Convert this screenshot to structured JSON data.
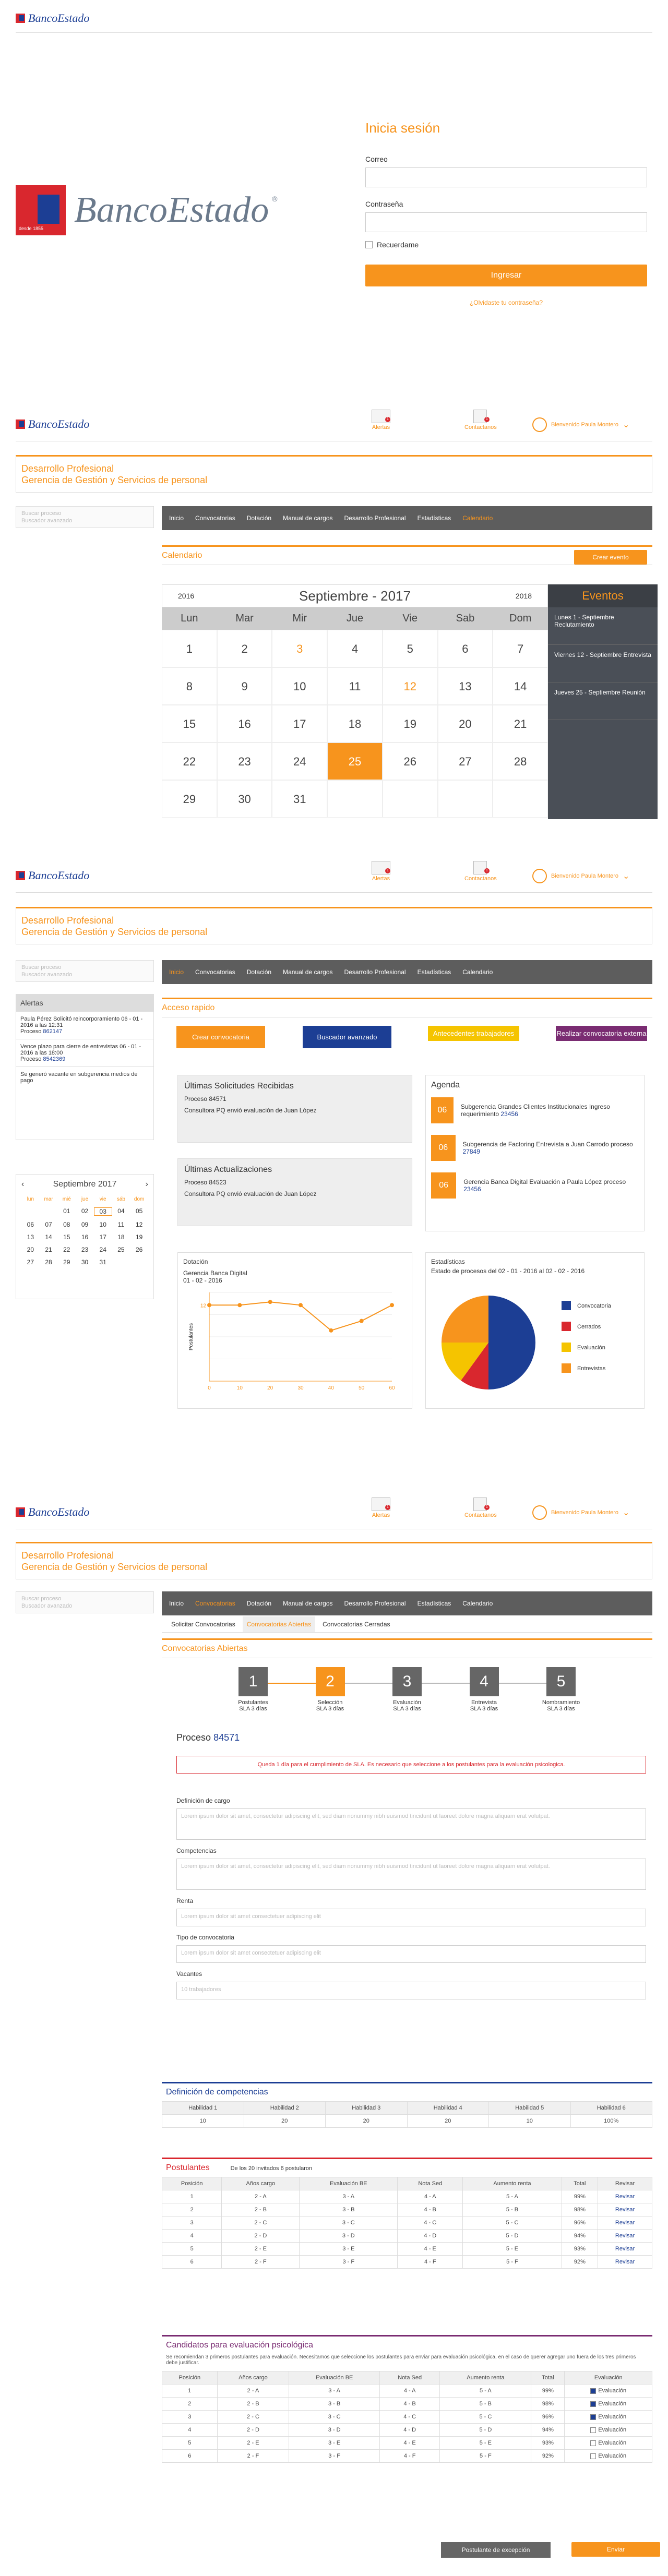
{
  "brand": {
    "name": "BancoEstado",
    "tagline": "desde 1855"
  },
  "login": {
    "title": "Inicia sesión",
    "user_label": "Correo",
    "pass_label": "Contraseña",
    "remember": "Recuerdame",
    "submit": "Ingresar",
    "forgot": "¿Olvidaste tu contraseña?"
  },
  "header": {
    "alerts": "Alertas",
    "alerts_count": "1",
    "contacts": "Contactanos",
    "contacts_count": "1",
    "user": "Bienvenido Paula Montero"
  },
  "page": {
    "title1": "Desarrollo Profesional",
    "title2": "Gerencia de Gestión y Servicios de personal"
  },
  "search": {
    "placeholder": "Buscar proceso",
    "hint": "Buscador avanzado"
  },
  "nav": [
    "Inicio",
    "Convocatorias",
    "Dotación",
    "Manual de cargos",
    "Desarrollo Profesional",
    "Estadísticas",
    "Calendario"
  ],
  "calendar": {
    "header": "Calendario",
    "new_event": "Crear evento",
    "prev_year": "2016",
    "next_year": "2018",
    "month": "Septiembre - 2017",
    "days": [
      "Lun",
      "Mar",
      "Mir",
      "Jue",
      "Vie",
      "Sab",
      "Dom"
    ],
    "weeks": [
      [
        "1",
        "2",
        "3",
        "4",
        "5",
        "6",
        "7"
      ],
      [
        "8",
        "9",
        "10",
        "11",
        "12",
        "13",
        "14"
      ],
      [
        "15",
        "16",
        "17",
        "18",
        "19",
        "20",
        "21"
      ],
      [
        "22",
        "23",
        "24",
        "25",
        "26",
        "27",
        "28"
      ],
      [
        "29",
        "30",
        "31",
        "",
        "",
        "",
        ""
      ]
    ],
    "events_title": "Eventos",
    "events": [
      "Lunes 1 - Septiembre Reclutamiento",
      "Viernes 12 - Septiembre Entrevista",
      "Jueves 25 - Septiembre Reunión"
    ]
  },
  "dashboard": {
    "alerts_title": "Alertas",
    "alerts": [
      {
        "text": "Paula Pérez Solicitó reincorporamiento 06 - 01 - 2016 a las 12:31",
        "proc": "Proceso",
        "id": "862147"
      },
      {
        "text": "Vence plazo para cierre de entrevistas 06 - 01 - 2016 a las 18:00",
        "proc": "Proceso",
        "id": "8542369"
      },
      {
        "text": "Se generó vacante en subgerencia medios de pago",
        "proc": "",
        "id": ""
      }
    ],
    "mini_cal": {
      "month": "Septiembre 2017",
      "days": [
        "lun",
        "mar",
        "mié",
        "jue",
        "vie",
        "sáb",
        "dom"
      ],
      "rows": [
        [
          "",
          "",
          "01",
          "02",
          "03",
          "04",
          "05"
        ],
        [
          "06",
          "07",
          "08",
          "09",
          "10",
          "11",
          "12"
        ],
        [
          "13",
          "14",
          "15",
          "16",
          "17",
          "18",
          "19"
        ],
        [
          "20",
          "21",
          "22",
          "23",
          "24",
          "25",
          "26"
        ],
        [
          "27",
          "28",
          "29",
          "30",
          "31",
          "",
          ""
        ]
      ]
    },
    "quick_title": "Acceso rapido",
    "quick": [
      "Crear convocatoria",
      "Buscador avanzado",
      "Antecedentes trabajadores",
      "Realizar convocatoria externa"
    ],
    "last_req_title": "Últimas Solicitudes Recibidas",
    "last_req": [
      "Proceso 84571",
      "Consultora PQ envió evaluación de Juan López"
    ],
    "last_upd_title": "Últimas Actualizaciones",
    "last_upd": [
      "Proceso 84523",
      "Consultora PQ envió evaluación de Juan López"
    ],
    "agenda_title": "Agenda",
    "agenda": [
      {
        "day": "06",
        "text": "Subgerencia Grandes Clientes Institucionales Ingreso requerimiento",
        "id": "23456"
      },
      {
        "day": "06",
        "text": "Subgerencia de Factoring Entrevista a Juan Carrodo proceso",
        "id": "27849"
      },
      {
        "day": "06",
        "text": "Gerencia Banca Digital Evaluación a Paula López proceso",
        "id": "23456"
      }
    ],
    "dotacion_title": "Dotación",
    "dotacion_sub": "Gerencia Banca Digital",
    "dotacion_date": "01 - 02 - 2016",
    "ylabel": "Postulantes",
    "stats_title": "Estadísticas",
    "stats_sub": "Estado de procesos del 02 - 01 - 2016 al 02 - 02 - 2016"
  },
  "chart_data": [
    {
      "type": "line",
      "x": [
        0,
        10,
        20,
        30,
        40,
        50,
        60
      ],
      "values": [
        12,
        12,
        12.5,
        12,
        8,
        9.5,
        12
      ],
      "xlabel": "",
      "ylabel": "Postulantes",
      "ylim": [
        0,
        14
      ]
    },
    {
      "type": "pie",
      "categories": [
        "Convocatoria",
        "Cerrados",
        "Evaluación",
        "Entrevistas"
      ],
      "values": [
        50,
        10,
        15,
        25
      ],
      "colors": [
        "#1c3e94",
        "#d9272e",
        "#f5c400",
        "#f7941d"
      ],
      "legend": "right"
    }
  ],
  "process": {
    "tabs": [
      "Solicitar Convocatorias",
      "Convocatorias Abiertas",
      "Convocatorias Cerradas"
    ],
    "header": "Convocatorias Abiertas",
    "steps": [
      {
        "n": "1",
        "label": "Postulantes",
        "sla": "SLA 3 días"
      },
      {
        "n": "2",
        "label": "Selección",
        "sla": "SLA 3 días"
      },
      {
        "n": "3",
        "label": "Evaluación",
        "sla": "SLA 3 días"
      },
      {
        "n": "4",
        "label": "Entrevista",
        "sla": "SLA 3 días"
      },
      {
        "n": "5",
        "label": "Nombramiento",
        "sla": "SLA 3 días"
      }
    ],
    "proc_label": "Proceso",
    "proc_id": "84571",
    "warning": "Queda 1 día para el cumplimiento de SLA. Es necesario que seleccione a los postulantes para la evaluación psicologica.",
    "fields": [
      {
        "label": "Definición de cargo",
        "value": "Lorem ipsum dolor sit amet, consectetur adipiscing elit, sed diam nonummy nibh euismod tincidunt ut laoreet dolore magna aliquam erat volutpat."
      },
      {
        "label": "Competencias",
        "value": "Lorem ipsum dolor sit amet, consectetur adipiscing elit, sed diam nonummy nibh euismod tincidunt ut laoreet dolore magna aliquam erat volutpat."
      },
      {
        "label": "Renta",
        "value": "Lorem ipsum dolor sit amet consectetuer adipiscing elit"
      },
      {
        "label": "Tipo de convocatoria",
        "value": "Lorem ipsum dolor sit amet consectetuer adipiscing elit"
      },
      {
        "label": "Vacantes",
        "value": "10 trabajadores"
      }
    ]
  },
  "competencias": {
    "title": "Definición de competencias",
    "headers": [
      "Habilidad 1",
      "Habilidad 2",
      "Habilidad 3",
      "Habilidad 4",
      "Habilidad 5",
      "Habilidad 6"
    ],
    "values": [
      "10",
      "20",
      "20",
      "20",
      "10",
      "100%"
    ]
  },
  "postulantes": {
    "title": "Postulantes",
    "sub": "De los 20 invitados 6 postularon",
    "headers": [
      "Posición",
      "Años cargo",
      "Evaluación BE",
      "Nota Sed",
      "Aumento renta",
      "Total",
      "Revisar"
    ],
    "rows": [
      [
        "1",
        "2 - A",
        "3 - A",
        "4 - A",
        "5 - A",
        "99%",
        "Revisar"
      ],
      [
        "2",
        "2 - B",
        "3 - B",
        "4 - B",
        "5 - B",
        "98%",
        "Revisar"
      ],
      [
        "3",
        "2 - C",
        "3 - C",
        "4 - C",
        "5 - C",
        "96%",
        "Revisar"
      ],
      [
        "4",
        "2 - D",
        "3 - D",
        "4 - D",
        "5 - D",
        "94%",
        "Revisar"
      ],
      [
        "5",
        "2 - E",
        "3 - E",
        "4 - E",
        "5 - E",
        "93%",
        "Revisar"
      ],
      [
        "6",
        "2 - F",
        "3 - F",
        "4 - F",
        "5 - F",
        "92%",
        "Revisar"
      ]
    ]
  },
  "candidatos": {
    "title": "Candidatos para evaluación psicológica",
    "note": "Se recomiendan 3 primeros postulantes para evaluación. Necesitamos que seleccione los postulantes para enviar para evaluación psicológica, en el caso de querer agregar uno fuera de los tres primeros debe justificar.",
    "headers": [
      "Posición",
      "Años cargo",
      "Evaluación BE",
      "Nota Sed",
      "Aumento renta",
      "Total",
      "Evaluación"
    ],
    "rows": [
      [
        "1",
        "2 - A",
        "3 - A",
        "4 - A",
        "5 - A",
        "99%",
        "Evaluación"
      ],
      [
        "2",
        "2 - B",
        "3 - B",
        "4 - B",
        "5 - B",
        "98%",
        "Evaluación"
      ],
      [
        "3",
        "2 - C",
        "3 - C",
        "4 - C",
        "5 - C",
        "96%",
        "Evaluación"
      ],
      [
        "4",
        "2 - D",
        "3 - D",
        "4 - D",
        "5 - D",
        "94%",
        "Evaluación"
      ],
      [
        "5",
        "2 - E",
        "3 - E",
        "4 - E",
        "5 - E",
        "93%",
        "Evaluación"
      ],
      [
        "6",
        "2 - F",
        "3 - F",
        "4 - F",
        "5 - F",
        "92%",
        "Evaluación"
      ]
    ],
    "checked": [
      true,
      true,
      true,
      false,
      false,
      false
    ],
    "btn_exception": "Postulante de excepción",
    "btn_send": "Enviar"
  }
}
